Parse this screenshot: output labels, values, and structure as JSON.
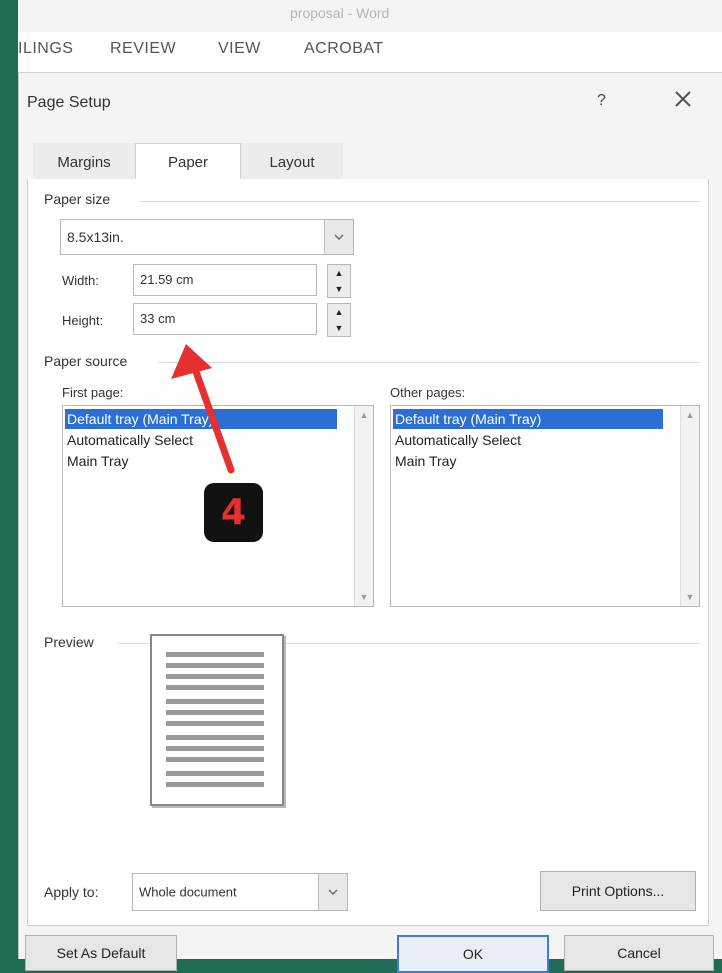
{
  "window": {
    "title": "proposal - Word"
  },
  "ribbon": {
    "tabs": [
      "ILINGS",
      "REVIEW",
      "VIEW",
      "ACROBAT"
    ]
  },
  "dialog": {
    "title": "Page Setup",
    "help": "?",
    "close_icon": "close-icon"
  },
  "tabs": [
    {
      "label": "Margins",
      "active": false
    },
    {
      "label": "Paper",
      "active": true
    },
    {
      "label": "Layout",
      "active": false
    }
  ],
  "paper_size": {
    "section_label": "Paper size",
    "selected": "8.5x13in.",
    "width_label": "Width:",
    "width_value": "21.59 cm",
    "height_label": "Height:",
    "height_value": "33 cm"
  },
  "paper_source": {
    "section_label": "Paper source",
    "first_page_label": "First page:",
    "other_pages_label": "Other pages:",
    "first_page_items": [
      "Default tray (Main Tray)",
      "Automatically Select",
      "Main Tray"
    ],
    "other_pages_items": [
      "Default tray (Main Tray)",
      "Automatically Select",
      "Main Tray"
    ],
    "selected_index": 0
  },
  "preview": {
    "section_label": "Preview"
  },
  "apply": {
    "label": "Apply to:",
    "value": "Whole document"
  },
  "buttons": {
    "print_options": "Print Options...",
    "set_as_default": "Set As Default",
    "ok": "OK",
    "cancel": "Cancel"
  },
  "annotation": {
    "step": "4",
    "color": "#e53030"
  }
}
